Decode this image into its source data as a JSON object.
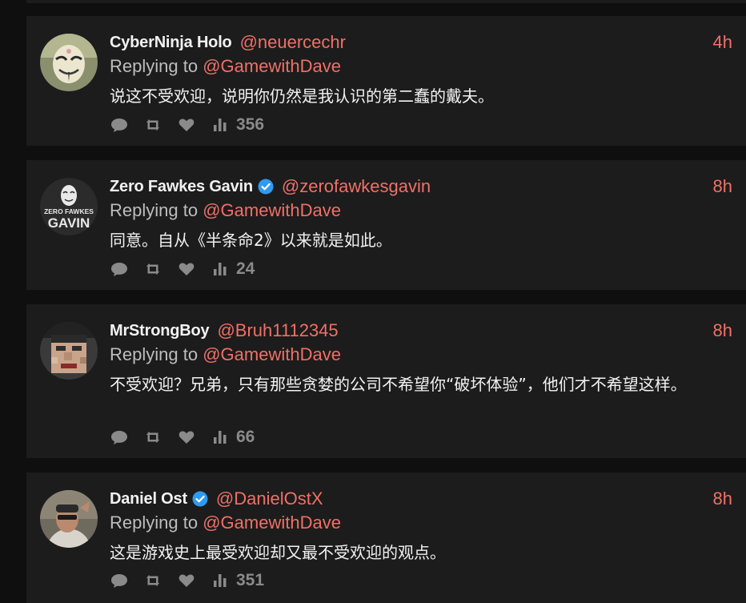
{
  "feed": {
    "reply_prefix": "Replying to",
    "tweets": [
      {
        "name": "CyberNinja Holo",
        "verified": false,
        "handle": "@neuercechr",
        "time": "4h",
        "reply_to": "@GamewithDave",
        "text": "说这不受欢迎，说明你仍然是我认识的第二蠢的戴夫。",
        "views": "356",
        "avatar_icon": "guy-fawkes-mask-avatar"
      },
      {
        "name": "Zero Fawkes Gavin",
        "verified": true,
        "handle": "@zerofawkesgavin",
        "time": "8h",
        "reply_to": "@GamewithDave",
        "text": "同意。自从《半条命2》以来就是如此。",
        "views": "24",
        "avatar_icon": "zero-fawkes-gavin-logo-avatar",
        "avatar_text_top": "ZERO FAWKES",
        "avatar_text_bottom": "GAVIN"
      },
      {
        "name": "MrStrongBoy",
        "verified": false,
        "handle": "@Bruh1112345",
        "time": "8h",
        "reply_to": "@GamewithDave",
        "text": "不受欢迎？兄弟，只有那些贪婪的公司不希望你“破坏体验”，他们才不希望这样。",
        "views": "66",
        "avatar_icon": "pixelated-face-avatar"
      },
      {
        "name": "Daniel Ost",
        "verified": true,
        "handle": "@DanielOstX",
        "time": "8h",
        "reply_to": "@GamewithDave",
        "text": "这是游戏史上最受欢迎却又最不受欢迎的观点。",
        "views": "351",
        "avatar_icon": "person-photo-avatar"
      }
    ]
  },
  "icons": {
    "reply": "reply-icon",
    "retweet": "retweet-icon",
    "like": "heart-icon",
    "views": "bar-chart-icon",
    "verified": "verified-badge-icon"
  },
  "colors": {
    "background": "#0f0f0f",
    "card": "#1c1c1c",
    "accent": "#f07067",
    "text": "#f2f2f2",
    "muted": "#8a8a8a",
    "verified": "#2f9bf0"
  }
}
